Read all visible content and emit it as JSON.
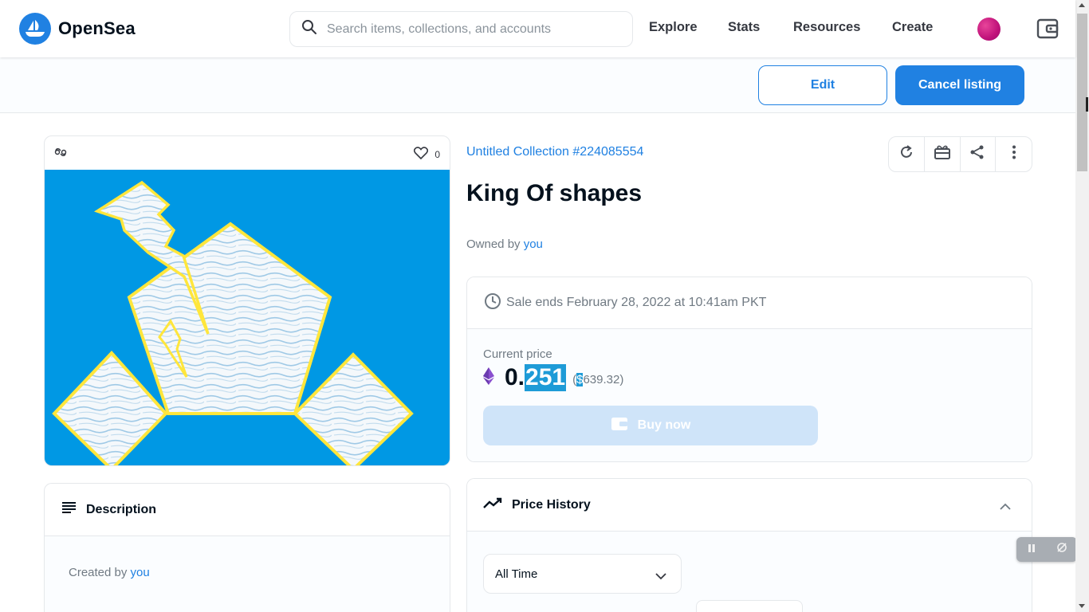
{
  "brand": {
    "name": "OpenSea",
    "accent": "#2081e2"
  },
  "search": {
    "placeholder": "Search items, collections, and accounts"
  },
  "nav": {
    "items": [
      "Explore",
      "Stats",
      "Resources",
      "Create"
    ]
  },
  "actions": {
    "edit_label": "Edit",
    "cancel_label": "Cancel listing"
  },
  "item": {
    "favorites": "0",
    "collection": "Untitled Collection #224085554",
    "title": "King Of shapes",
    "owned_prefix": "Owned by",
    "owner": "you"
  },
  "sale": {
    "ends_text": "Sale ends February 28, 2022 at 10:41am PKT",
    "current_label": "Current price",
    "price_prefix": "0.",
    "price_selected": "251",
    "usd_open": "(",
    "usd_selected": "$",
    "usd_rest": "639.32)",
    "buy_label": "Buy now"
  },
  "description": {
    "title": "Description",
    "created_prefix": "Created by",
    "creator": "you"
  },
  "price_history": {
    "title": "Price History",
    "range": "All Time"
  },
  "icons": [
    "opensea-logo-icon",
    "search-icon",
    "wallet-icon",
    "chain-icon",
    "heart-icon",
    "refresh-icon",
    "gift-icon",
    "share-icon",
    "more-icon",
    "clock-icon",
    "ethereum-icon",
    "description-icon",
    "trending-icon",
    "chevron-up-icon",
    "chevron-down-icon",
    "pause-icon",
    "capture-icon"
  ]
}
